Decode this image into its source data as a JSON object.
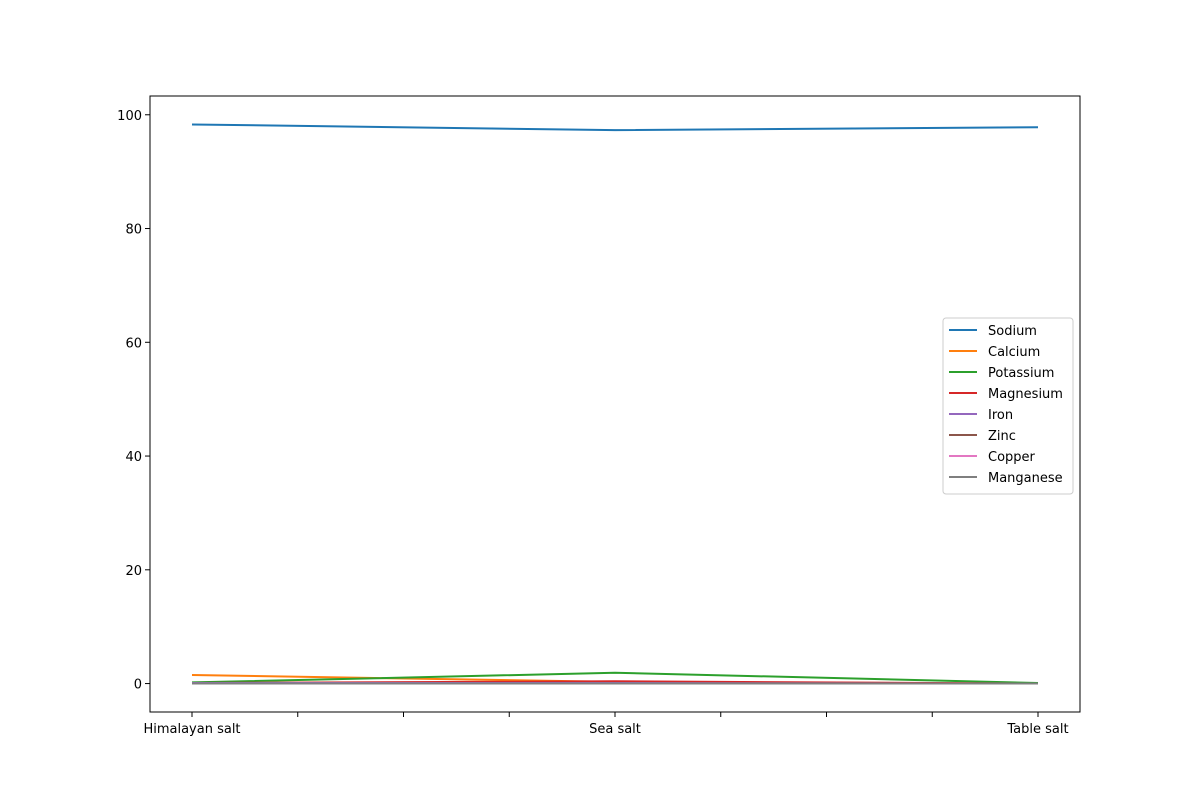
{
  "chart_data": {
    "type": "line",
    "title": "",
    "xlabel": "",
    "ylabel": "",
    "categories": [
      "Himalayan salt",
      "Sea salt",
      "Table salt"
    ],
    "ylim": [
      -5,
      103.3
    ],
    "yticks": [
      0,
      20,
      40,
      60,
      80,
      100
    ],
    "grid": false,
    "legend_position": "center-right",
    "series": [
      {
        "name": "Sodium",
        "color": "#1f77b4",
        "values": [
          98.3,
          97.3,
          97.8
        ]
      },
      {
        "name": "Calcium",
        "color": "#ff7f0e",
        "values": [
          1.5,
          0.3,
          0.0
        ]
      },
      {
        "name": "Potassium",
        "color": "#2ca02c",
        "values": [
          0.2,
          1.9,
          0.1
        ]
      },
      {
        "name": "Magnesium",
        "color": "#d62728",
        "values": [
          0.1,
          0.4,
          0.0
        ]
      },
      {
        "name": "Iron",
        "color": "#9467bd",
        "values": [
          0.1,
          0.1,
          0.0
        ]
      },
      {
        "name": "Zinc",
        "color": "#8c564b",
        "values": [
          0.0,
          0.0,
          0.0
        ]
      },
      {
        "name": "Copper",
        "color": "#e377c2",
        "values": [
          0.0,
          0.0,
          0.0
        ]
      },
      {
        "name": "Manganese",
        "color": "#7f7f7f",
        "values": [
          0.0,
          0.0,
          0.0
        ]
      }
    ]
  }
}
